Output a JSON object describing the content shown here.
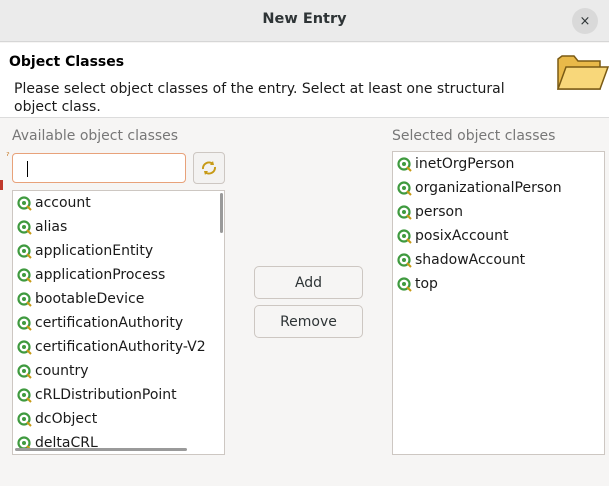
{
  "window": {
    "title": "New Entry",
    "close_icon": "×"
  },
  "header": {
    "section_title": "Object Classes",
    "description": "Please select object classes of the entry. Select at least one structural object class.",
    "image_icon": "folder-icon"
  },
  "available": {
    "label": "Available object classes",
    "search": {
      "value": "",
      "placeholder": ""
    },
    "refresh_icon": "refresh-icon",
    "items": [
      "account",
      "alias",
      "applicationEntity",
      "applicationProcess",
      "bootableDevice",
      "certificationAuthority",
      "certificationAuthority-V2",
      "country",
      "cRLDistributionPoint",
      "dcObject",
      "deltaCRL"
    ]
  },
  "actions": {
    "add_label": "Add",
    "remove_label": "Remove"
  },
  "selected": {
    "label": "Selected object classes",
    "items": [
      "inetOrgPerson",
      "organizationalPerson",
      "person",
      "posixAccount",
      "shadowAccount",
      "top"
    ]
  },
  "colors": {
    "focus_border": "#e8a27a",
    "icon_green": "#3f9a3f"
  }
}
